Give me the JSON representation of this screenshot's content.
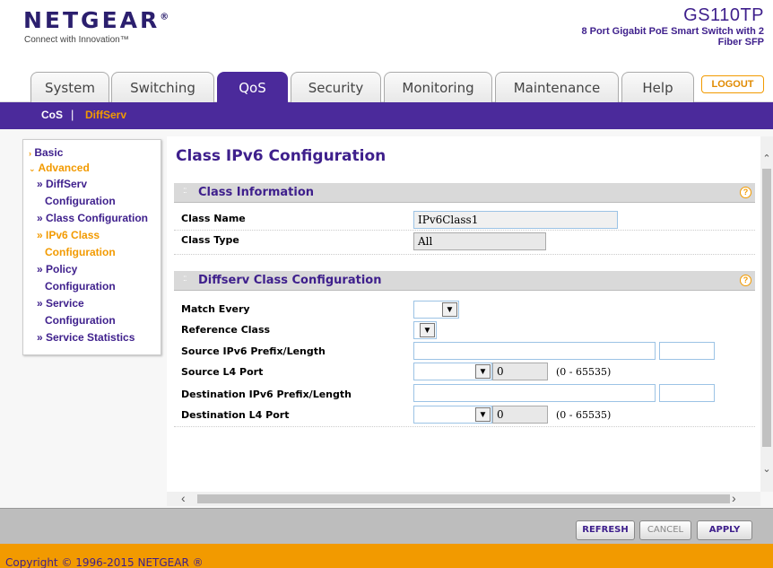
{
  "brand": {
    "logo": "NETGEAR",
    "logo_mark": "®",
    "tagline": "Connect with Innovation™",
    "model_name": "GS110TP",
    "model_desc": "8 Port Gigabit PoE Smart Switch with 2 Fiber SFP"
  },
  "tabs": [
    {
      "label": "System",
      "active": false
    },
    {
      "label": "Switching",
      "active": false
    },
    {
      "label": "QoS",
      "active": true
    },
    {
      "label": "Security",
      "active": false
    },
    {
      "label": "Monitoring",
      "active": false
    },
    {
      "label": "Maintenance",
      "active": false
    },
    {
      "label": "Help",
      "active": false
    }
  ],
  "logout_label": "LOGOUT",
  "subnav": {
    "items": [
      {
        "label": "CoS",
        "color": "#ffffff"
      },
      {
        "label": "DiffServ",
        "color": "#f29a00"
      }
    ],
    "separator": "|"
  },
  "leftnav": {
    "basic": "Basic",
    "advanced": "Advanced",
    "items": [
      {
        "label": "» DiffServ Configuration",
        "line1": "» DiffServ",
        "line2": "Configuration",
        "active": false
      },
      {
        "label": "» Class Configuration",
        "line1": "» Class Configuration",
        "line2": "",
        "active": false
      },
      {
        "label": "» IPv6 Class Configuration",
        "line1": "» IPv6 Class",
        "line2": "Configuration",
        "active": true
      },
      {
        "label": "» Policy Configuration",
        "line1": "» Policy",
        "line2": "Configuration",
        "active": false
      },
      {
        "label": "» Service Configuration",
        "line1": "» Service",
        "line2": "Configuration",
        "active": false
      },
      {
        "label": "» Service Statistics",
        "line1": "» Service Statistics",
        "line2": "",
        "active": false
      }
    ]
  },
  "page": {
    "title": "Class IPv6 Configuration",
    "class_info": {
      "heading": "Class Information",
      "class_name_label": "Class Name",
      "class_name_value": "IPv6Class1",
      "class_type_label": "Class Type",
      "class_type_value": "All"
    },
    "diffserv": {
      "heading": "Diffserv Class Configuration",
      "match_every_label": "Match Every",
      "match_every_value": "",
      "reference_class_label": "Reference Class",
      "reference_class_value": "",
      "src_prefix_label": "Source IPv6 Prefix/Length",
      "src_prefix_value": "",
      "src_length_value": "",
      "src_port_label": "Source L4 Port",
      "src_port_select": "",
      "src_port_value": "0",
      "src_port_range": "(0 - 65535)",
      "dst_prefix_label": "Destination IPv6 Prefix/Length",
      "dst_prefix_value": "",
      "dst_length_value": "",
      "dst_port_label": "Destination L4 Port",
      "dst_port_select": "",
      "dst_port_value": "0",
      "dst_port_range": "(0 - 65535)"
    }
  },
  "buttons": {
    "refresh": "REFRESH",
    "cancel": "CANCEL",
    "apply": "APPLY"
  },
  "copyright": "Copyright © 1996-2015 NETGEAR ®",
  "icons": {
    "help": "question-circle-icon",
    "dropdown": "chevron-down-icon"
  },
  "colors": {
    "brand_purple": "#4b2a9b",
    "accent_orange": "#f29a00",
    "title_purple": "#3e1f8c"
  }
}
